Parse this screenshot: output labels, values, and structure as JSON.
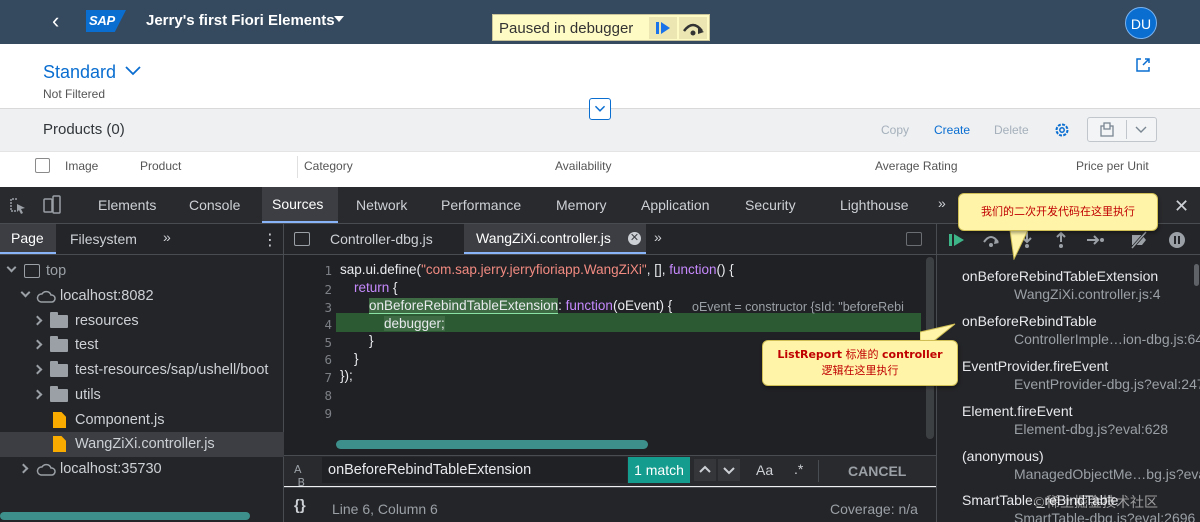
{
  "shell": {
    "logo": "SAP",
    "app_title": "Jerry's first Fiori Elements",
    "paused_label": "Paused in debugger",
    "avatar_initials": "DU"
  },
  "header": {
    "variant": "Standard",
    "filter_status": "Not Filtered"
  },
  "table": {
    "title": "Products (0)",
    "toolbar": {
      "copy": "Copy",
      "create": "Create",
      "delete": "Delete"
    },
    "columns": [
      "Image",
      "Product",
      "Category",
      "Availability",
      "Average Rating",
      "Price per Unit"
    ]
  },
  "devtools": {
    "tabs": [
      "Elements",
      "Console",
      "Sources",
      "Network",
      "Performance",
      "Memory",
      "Application",
      "Security",
      "Lighthouse"
    ],
    "active_tab": "Sources",
    "more_tabs": "»"
  },
  "navigator": {
    "tabs": {
      "page": "Page",
      "filesystem": "Filesystem",
      "more": "»"
    },
    "tree": [
      {
        "label": "top",
        "level": 0,
        "kind": "frame",
        "expanded": true
      },
      {
        "label": "localhost:8082",
        "level": 1,
        "kind": "cloud",
        "expanded": true
      },
      {
        "label": "resources",
        "level": 2,
        "kind": "folder",
        "expanded": false
      },
      {
        "label": "test",
        "level": 2,
        "kind": "folder",
        "expanded": false
      },
      {
        "label": "test-resources/sap/ushell/boot",
        "level": 2,
        "kind": "folder",
        "expanded": false
      },
      {
        "label": "utils",
        "level": 2,
        "kind": "folder",
        "expanded": false
      },
      {
        "label": "Component.js",
        "level": 2,
        "kind": "file"
      },
      {
        "label": "WangZiXi.controller.js",
        "level": 2,
        "kind": "file",
        "selected": true
      },
      {
        "label": "localhost:35730",
        "level": 1,
        "kind": "cloud",
        "expanded": false
      }
    ]
  },
  "editor": {
    "tabs": [
      "Controller-dbg.js",
      "WangZiXi.controller.js"
    ],
    "active_tab_index": 1,
    "line_numbers": [
      "1",
      "2",
      "3",
      "4",
      "5",
      "6",
      "7",
      "8",
      "9"
    ],
    "code": {
      "l1_pre": "sap.ui.define(",
      "l1_str": "\"com.sap.jerry.jerryfioriapp.WangZiXi\"",
      "l1_mid": ", [], ",
      "l1_kw": "function",
      "l1_post": "() {",
      "l2_kw": "return",
      "l2_post": " {",
      "l3_fn": "onBeforeRebindTableExtension",
      "l3_mid": ": ",
      "l3_kw": "function",
      "l3_post": "(oEvent) {",
      "l3_inline": "oEvent = constructor {sId: \"beforeRebi",
      "l4": "debugger;",
      "l5": "}",
      "l6": "}",
      "l7": "});",
      "l7_kw": "}",
      "l7_post": ");"
    }
  },
  "search": {
    "query": "onBeforeRebindTableExtension",
    "match_count": "1 match",
    "case_label": "Aa",
    "regex_label": ".*",
    "cancel": "CANCEL"
  },
  "status": {
    "position": "Line 6, Column 6",
    "coverage": "Coverage: n/a"
  },
  "callstack": [
    {
      "fn": "onBeforeRebindTableExtension",
      "loc": "WangZiXi.controller.js:4"
    },
    {
      "fn": "onBeforeRebindTable",
      "loc": "ControllerImple…ion-dbg.js:641"
    },
    {
      "fn": "EventProvider.fireEvent",
      "loc": "EventProvider-dbg.js?eval:247"
    },
    {
      "fn": "Element.fireEvent",
      "loc": "Element-dbg.js?eval:628"
    },
    {
      "fn": "(anonymous)",
      "loc": "ManagedObjectMe…bg.js?eval:78"
    },
    {
      "fn": "SmartTable._reBindTable",
      "loc": "SmartTable-dbg.js?eval:2696"
    }
  ],
  "annotations": {
    "callout1": "我们的二次开发代码在这里执行",
    "callout2_line1_en": "ListReport",
    "callout2_line1_cn": " 标准的 ",
    "callout2_line1_en2": "controller",
    "callout2_line2": "逻辑在这里执行",
    "watermark": "©稀土掘金技术社区"
  },
  "colors": {
    "shell": "#354a5f",
    "fiori_blue": "#0a6ed1",
    "devtools_bg": "#242528",
    "match_teal": "#149c8e",
    "exec_line": "#2b5a33",
    "callout_fill": "#fff4a8",
    "callout_text": "#c00000"
  }
}
